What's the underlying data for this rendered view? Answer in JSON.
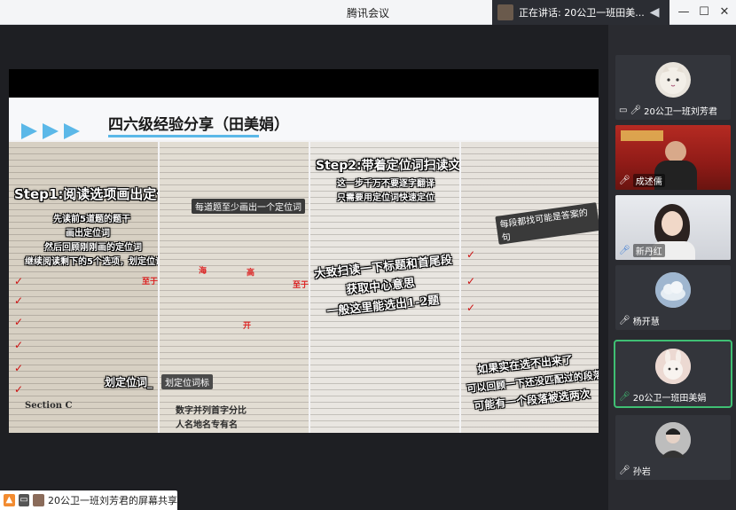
{
  "window": {
    "title": "腾讯会议",
    "speaking_label": "正在讲话: 20公卫一班田美...",
    "minimize_glyph": "—",
    "maximize_glyph": "☐",
    "close_glyph": "✕"
  },
  "slide": {
    "title": "四六级经验分享（田美娟）",
    "accent_color": "#5bb8e8",
    "annotations": {
      "step1": "Step1:阅读选项画出定位词_",
      "step1_notes": [
        "先读前5道题的题干",
        "画出定位词",
        "然后回顾刚刚画的定位词",
        "继续阅读剩下的5个选项，划定位词"
      ],
      "step1_mark": "划定位词_",
      "marker_a": "至于",
      "marker_b": "海",
      "marker_c": "高",
      "marker_d": "开",
      "page2_note": "每道题至少画出一个定位词",
      "page2_box": "划定位词标",
      "page2_bottom": [
        "数字并列首字分比",
        "人名地名专有名"
      ],
      "step2": "Step2:带着定位词扫读文章_",
      "step2_notes": [
        "这一步千万不要逐字翻译",
        "只需要用定位词快速定位"
      ],
      "step2_body": [
        "大致扫读一下标题和首尾段",
        "获取中心意思",
        "一般这里能选出1-2题"
      ],
      "page4_note": "每段都找可能是答案的句",
      "page4_body": [
        "如果实在选不出来了",
        "可以回顾一下还没匹配过的段落",
        "可能有一个段落被选两次"
      ],
      "section_c": "Section C"
    }
  },
  "share_bar": {
    "label": "20公卫一班刘芳君的屏幕共享"
  },
  "participants": [
    {
      "name": "20公卫一班刘芳君",
      "kind": "avatar-cat",
      "show_icons": true
    },
    {
      "name": "成述儒",
      "kind": "video"
    },
    {
      "name": "新丹红",
      "kind": "video-girl"
    },
    {
      "name": "杨开慧",
      "kind": "avatar-cloud"
    },
    {
      "name": "20公卫一班田美娟",
      "kind": "avatar-rabbit",
      "active": true
    },
    {
      "name": "孙岩",
      "kind": "avatar-man"
    }
  ]
}
